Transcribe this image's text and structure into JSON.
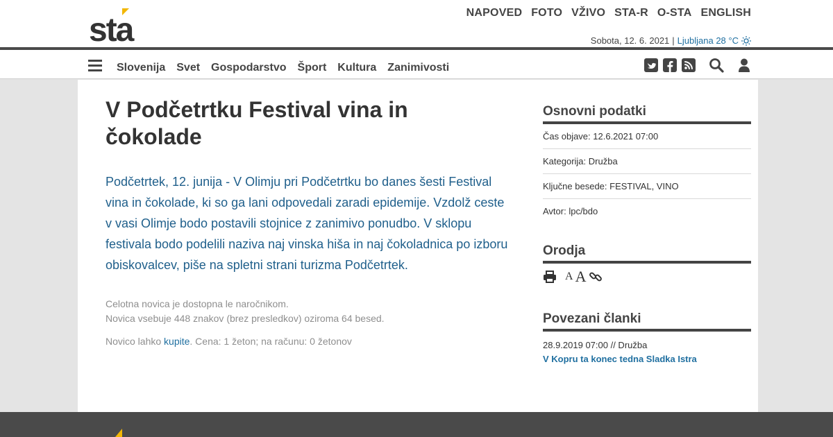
{
  "header": {
    "logo_text": "sta",
    "topnav": [
      "NAPOVED",
      "FOTO",
      "VŽIVO",
      "STA-R",
      "O-STA",
      "ENGLISH"
    ],
    "date": "Sobota, 12. 6. 2021",
    "separator": "|",
    "weather": "Ljubljana 28 °C"
  },
  "nav": {
    "items": [
      "Slovenija",
      "Svet",
      "Gospodarstvo",
      "Šport",
      "Kultura",
      "Zanimivosti"
    ],
    "icons": [
      "twitter-icon",
      "facebook-icon",
      "rss-icon",
      "search-icon",
      "user-icon"
    ]
  },
  "article": {
    "title": "V Podčetrtku Festival vina in čokolade",
    "lead": "Podčetrtek, 12. junija - V Olimju pri Podčetrtku bo danes šesti Festival vina in čokolade, ki so ga lani odpovedali zaradi epidemije. Vzdolž ceste v vasi Olimje bodo postavili stojnice z zanimivo ponudbo. V sklopu festivala bodo podelili naziva naj vinska hiša in naj čokoladnica po izboru obiskovalcev, piše na spletni strani turizma Podčetrtek.",
    "notice_line1": "Celotna novica je dostopna le naročnikom.",
    "notice_line2": "Novica vsebuje 448 znakov (brez presledkov) oziroma 64 besed.",
    "buy_prefix": "Novico lahko",
    "buy_link": "kupite",
    "buy_suffix": ". Cena: 1 žeton; na računu: 0 žetonov"
  },
  "sidebar": {
    "basic_title": "Osnovni podatki",
    "rows": [
      "Čas objave: 12.6.2021 07:00",
      "Kategorija: Družba",
      "Ključne besede: FESTIVAL, VINO",
      "Avtor: lpc/bdo"
    ],
    "tools_title": "Orodja",
    "tools": {
      "font_small": "A",
      "font_large": "A"
    },
    "related_title": "Povezani članki",
    "related": [
      {
        "meta": "28.9.2019 07:00 // Družba",
        "title": "V Kopru ta konec tedna Sladka Istra"
      }
    ]
  },
  "colors": {
    "brand_dark": "#333333",
    "brand_accent": "#f2b705",
    "link": "#1f6fa0",
    "lead_text": "#1f5f8b"
  }
}
